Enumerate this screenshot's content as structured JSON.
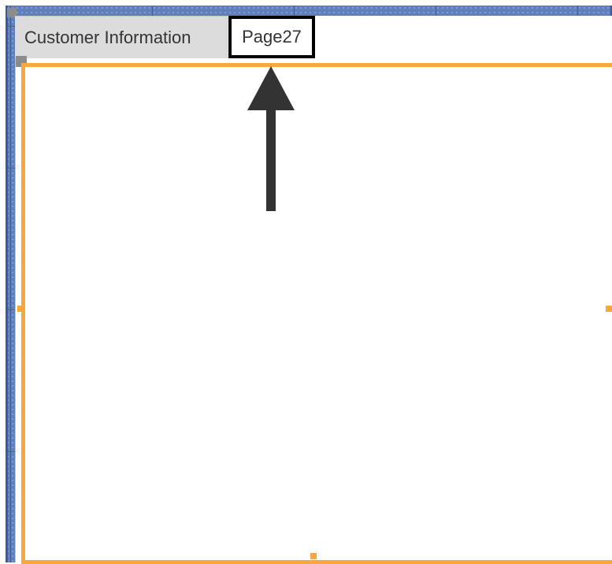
{
  "tabs": [
    {
      "label": "Customer Information",
      "selected": false
    },
    {
      "label": "Page27",
      "selected": true,
      "highlighted": true
    }
  ],
  "annotation": {
    "icon": "up-arrow-icon",
    "color": "#333333"
  },
  "colors": {
    "design_grid": "#5f7fbd",
    "selection_border": "#f8a83b",
    "tab_inactive": "#dcdcdc",
    "tab_highlight_border": "#000000"
  }
}
